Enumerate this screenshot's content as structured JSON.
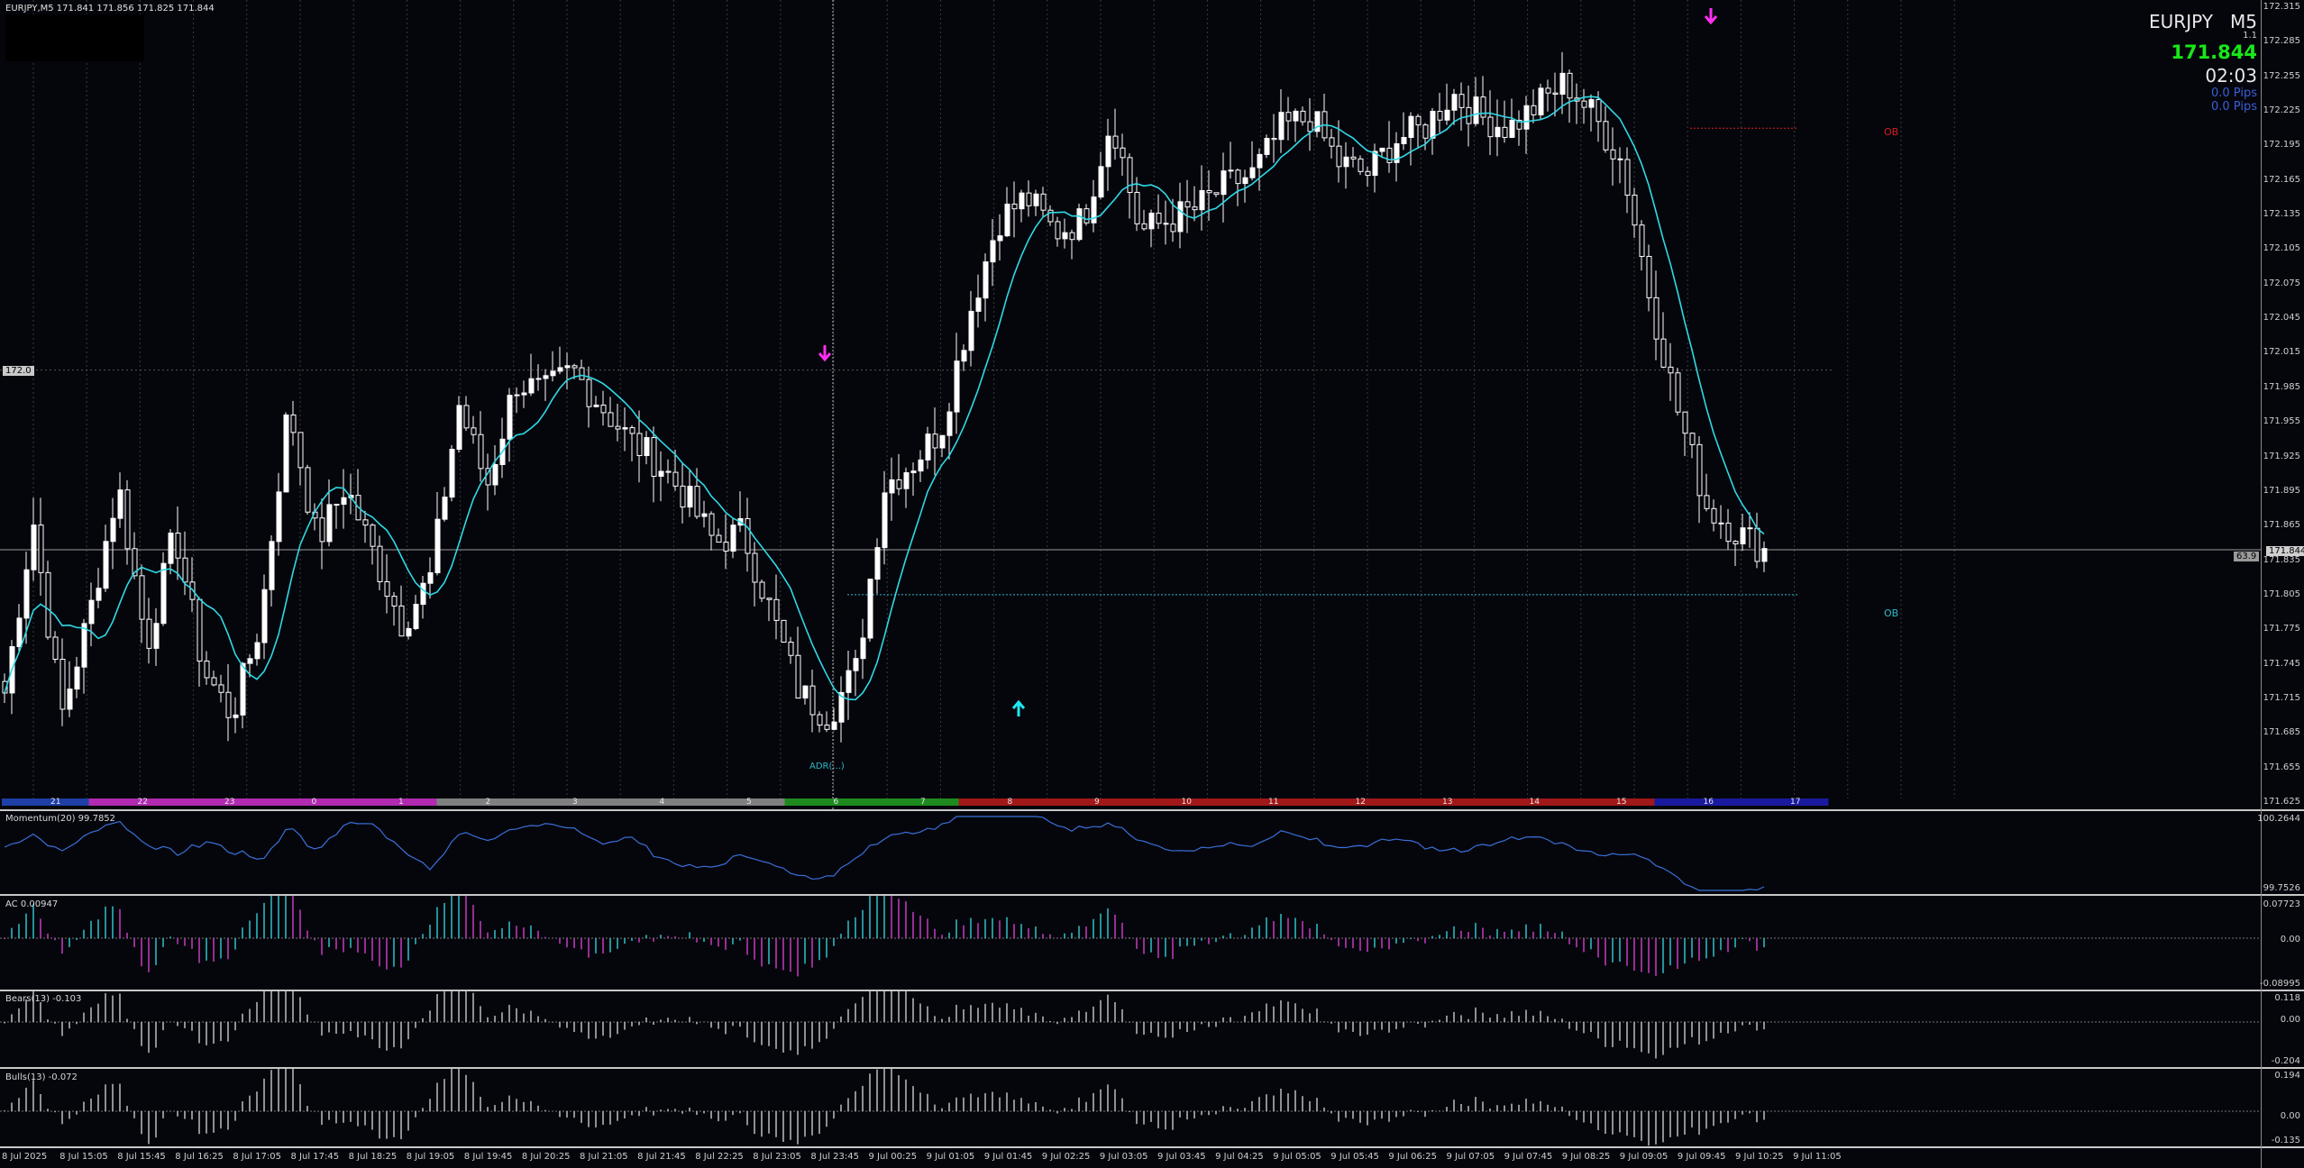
{
  "header": {
    "symbol_line": "EURJPY,M5  171.841 171.856 171.825 171.844",
    "symbol": "EURJPY",
    "timeframe": "M5",
    "version": "1.1",
    "price": "171.844",
    "countdown": "02:03",
    "pips1": "0.0 Pips",
    "pips2": "0.0 Pips"
  },
  "tags": {
    "left_level": "172.0",
    "current_price": "171.844",
    "right_value": "63.9",
    "adr_label": "ADR(...)",
    "ob_top": "OB",
    "ob_bottom": "OB"
  },
  "main_axis": [
    "172.315",
    "172.285",
    "172.255",
    "172.225",
    "172.195",
    "172.165",
    "172.135",
    "172.105",
    "172.075",
    "172.045",
    "172.015",
    "171.985",
    "171.955",
    "171.925",
    "171.895",
    "171.865",
    "171.835",
    "171.805",
    "171.775",
    "171.745",
    "171.715",
    "171.685",
    "171.655",
    "171.625"
  ],
  "hour_labels": [
    "21",
    "22",
    "23",
    "0",
    "1",
    "2",
    "3",
    "4",
    "5",
    "6",
    "7",
    "8",
    "9",
    "10",
    "11",
    "12",
    "13",
    "14",
    "15",
    "16",
    "17"
  ],
  "session_colors": [
    "#1d3fa6",
    "#b02bb0",
    "#808080",
    "#1e8a1e",
    "#a01818",
    "#1a1aa0"
  ],
  "indicators": {
    "momentum": {
      "label": "Momentum(20) 99.7852",
      "top": "100.2644",
      "bottom": "99.7526"
    },
    "ac": {
      "label": "AC 0.00947",
      "top": "0.07723",
      "mid": "0.00",
      "bottom": "-0.08995"
    },
    "bears": {
      "label": "Bears(13) -0.103",
      "top": "0.118",
      "mid": "0.00",
      "bottom": "-0.204"
    },
    "bulls": {
      "label": "Bulls(13) -0.072",
      "top": "0.194",
      "mid": "0.00",
      "bottom": "-0.135"
    }
  },
  "time_labels": [
    "8 Jul 2025",
    "8 Jul 15:05",
    "8 Jul 15:45",
    "8 Jul 16:25",
    "8 Jul 17:05",
    "8 Jul 17:45",
    "8 Jul 18:25",
    "8 Jul 19:05",
    "8 Jul 19:45",
    "8 Jul 20:25",
    "8 Jul 21:05",
    "8 Jul 21:45",
    "8 Jul 22:25",
    "8 Jul 23:05",
    "8 Jul 23:45",
    "9 Jul 00:25",
    "9 Jul 01:05",
    "9 Jul 01:45",
    "9 Jul 02:25",
    "9 Jul 03:05",
    "9 Jul 03:45",
    "9 Jul 04:25",
    "9 Jul 05:05",
    "9 Jul 05:45",
    "9 Jul 06:25",
    "9 Jul 07:05",
    "9 Jul 07:45",
    "9 Jul 08:25",
    "9 Jul 09:05",
    "9 Jul 09:45",
    "9 Jul 10:25",
    "9 Jul 11:05"
  ],
  "colors": {
    "background": "#05060c",
    "candle": "#ffffff",
    "ma": "#2fd9e6",
    "arrow_down": "#ff2ef0",
    "arrow_up": "#20e8f0",
    "price_green": "#18e818",
    "pips_blue": "#3a5fd9",
    "ob_red": "#d42020",
    "ob_cyan": "#2fb8c8",
    "momentum": "#3a6fd8",
    "ac_up": "#2fc0c8",
    "ac_down": "#c83ac0"
  },
  "icons": {
    "down_arrow": "down-arrow-icon",
    "up_arrow": "up-arrow-icon"
  },
  "chart_data": {
    "type": "candlestick",
    "close_anchors": [
      [
        "8 Jul 14:25",
        171.72
      ],
      [
        "8 Jul 14:45",
        171.87
      ],
      [
        "8 Jul 15:05",
        171.7
      ],
      [
        "8 Jul 15:25",
        171.79
      ],
      [
        "8 Jul 15:45",
        171.9
      ],
      [
        "8 Jul 16:05",
        171.76
      ],
      [
        "8 Jul 16:25",
        171.86
      ],
      [
        "8 Jul 16:45",
        171.74
      ],
      [
        "8 Jul 17:05",
        171.7
      ],
      [
        "8 Jul 17:25",
        171.78
      ],
      [
        "8 Jul 17:45",
        171.97
      ],
      [
        "8 Jul 18:05",
        171.85
      ],
      [
        "8 Jul 18:25",
        171.9
      ],
      [
        "8 Jul 18:45",
        171.84
      ],
      [
        "8 Jul 19:05",
        171.78
      ],
      [
        "8 Jul 19:25",
        171.82
      ],
      [
        "8 Jul 19:45",
        171.97
      ],
      [
        "8 Jul 20:05",
        171.9
      ],
      [
        "8 Jul 20:25",
        171.99
      ],
      [
        "8 Jul 20:45",
        171.98
      ],
      [
        "8 Jul 21:05",
        172.0
      ],
      [
        "8 Jul 21:25",
        171.97
      ],
      [
        "8 Jul 21:45",
        171.94
      ],
      [
        "8 Jul 22:05",
        171.92
      ],
      [
        "8 Jul 22:25",
        171.89
      ],
      [
        "8 Jul 22:45",
        171.85
      ],
      [
        "8 Jul 23:05",
        171.86
      ],
      [
        "8 Jul 23:25",
        171.79
      ],
      [
        "8 Jul 23:45",
        171.72
      ],
      [
        "9 Jul 00:05",
        171.7
      ],
      [
        "9 Jul 00:25",
        171.74
      ],
      [
        "9 Jul 00:45",
        171.9
      ],
      [
        "9 Jul 01:05",
        171.92
      ],
      [
        "9 Jul 01:25",
        171.95
      ],
      [
        "9 Jul 01:45",
        172.05
      ],
      [
        "9 Jul 02:05",
        172.13
      ],
      [
        "9 Jul 02:25",
        172.15
      ],
      [
        "9 Jul 02:45",
        172.12
      ],
      [
        "9 Jul 03:05",
        172.13
      ],
      [
        "9 Jul 03:25",
        172.22
      ],
      [
        "9 Jul 03:45",
        172.12
      ],
      [
        "9 Jul 04:05",
        172.13
      ],
      [
        "9 Jul 04:25",
        172.14
      ],
      [
        "9 Jul 04:45",
        172.16
      ],
      [
        "9 Jul 05:05",
        172.17
      ],
      [
        "9 Jul 05:25",
        172.21
      ],
      [
        "9 Jul 05:45",
        172.22
      ],
      [
        "9 Jul 06:05",
        172.18
      ],
      [
        "9 Jul 06:25",
        172.17
      ],
      [
        "9 Jul 06:45",
        172.2
      ],
      [
        "9 Jul 07:05",
        172.21
      ],
      [
        "9 Jul 07:25",
        172.24
      ],
      [
        "9 Jul 07:45",
        172.22
      ],
      [
        "9 Jul 08:05",
        172.21
      ],
      [
        "9 Jul 08:25",
        172.23
      ],
      [
        "9 Jul 08:45",
        172.25
      ],
      [
        "9 Jul 09:05",
        172.22
      ],
      [
        "9 Jul 09:25",
        172.18
      ],
      [
        "9 Jul 09:45",
        172.06
      ],
      [
        "9 Jul 10:05",
        171.96
      ],
      [
        "9 Jul 10:25",
        171.88
      ],
      [
        "9 Jul 10:45",
        171.86
      ],
      [
        "9 Jul 11:05",
        171.844
      ]
    ]
  }
}
